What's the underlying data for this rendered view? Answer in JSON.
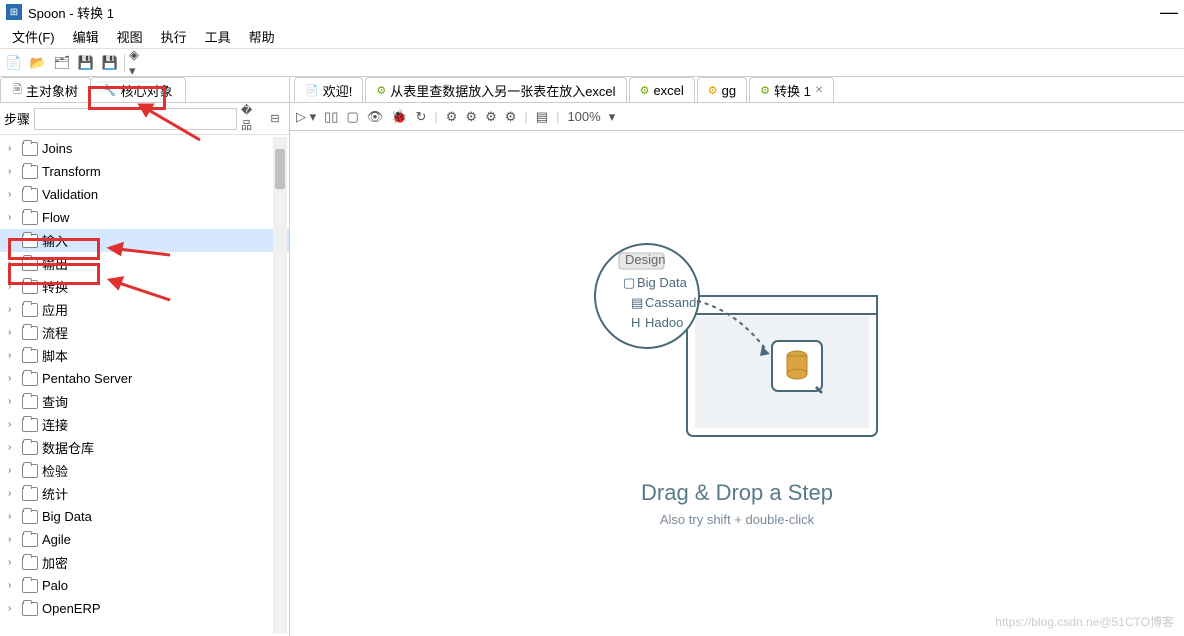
{
  "titlebar": {
    "title": "Spoon - 转换 1"
  },
  "menu": [
    "文件(F)",
    "编辑",
    "视图",
    "执行",
    "工具",
    "帮助"
  ],
  "leftTabs": [
    {
      "label": "主对象树"
    },
    {
      "label": "核心对象"
    }
  ],
  "stepLabel": "步骤",
  "tree": [
    {
      "label": "Joins"
    },
    {
      "label": "Transform"
    },
    {
      "label": "Validation"
    },
    {
      "label": "Flow"
    },
    {
      "label": "输入"
    },
    {
      "label": "输出"
    },
    {
      "label": "转换"
    },
    {
      "label": "应用"
    },
    {
      "label": "流程"
    },
    {
      "label": "脚本"
    },
    {
      "label": "Pentaho Server"
    },
    {
      "label": "查询"
    },
    {
      "label": "连接"
    },
    {
      "label": "数据仓库"
    },
    {
      "label": "检验"
    },
    {
      "label": "统计"
    },
    {
      "label": "Big Data"
    },
    {
      "label": "Agile"
    },
    {
      "label": "加密"
    },
    {
      "label": "Palo"
    },
    {
      "label": "OpenERP"
    }
  ],
  "rightTabs": [
    {
      "label": "欢迎!",
      "icon": "📄",
      "color": "#555"
    },
    {
      "label": "从表里查数据放入另一张表在放入excel",
      "icon": "⚙",
      "color": "#6a0"
    },
    {
      "label": "excel",
      "icon": "⚙",
      "color": "#6a0"
    },
    {
      "label": "gg",
      "icon": "⚙",
      "color": "#d90"
    },
    {
      "label": "转换 1",
      "icon": "⚙",
      "color": "#6a0",
      "active": true
    }
  ],
  "zoom": "100%",
  "illus": {
    "tab": "Design",
    "items": [
      "Big Data",
      "Cassandr",
      "Hadoo"
    ],
    "title": "Drag & Drop a Step",
    "sub": "Also try shift + double-click"
  },
  "watermark": "https://blog.csdn.ne@51CTO博客"
}
